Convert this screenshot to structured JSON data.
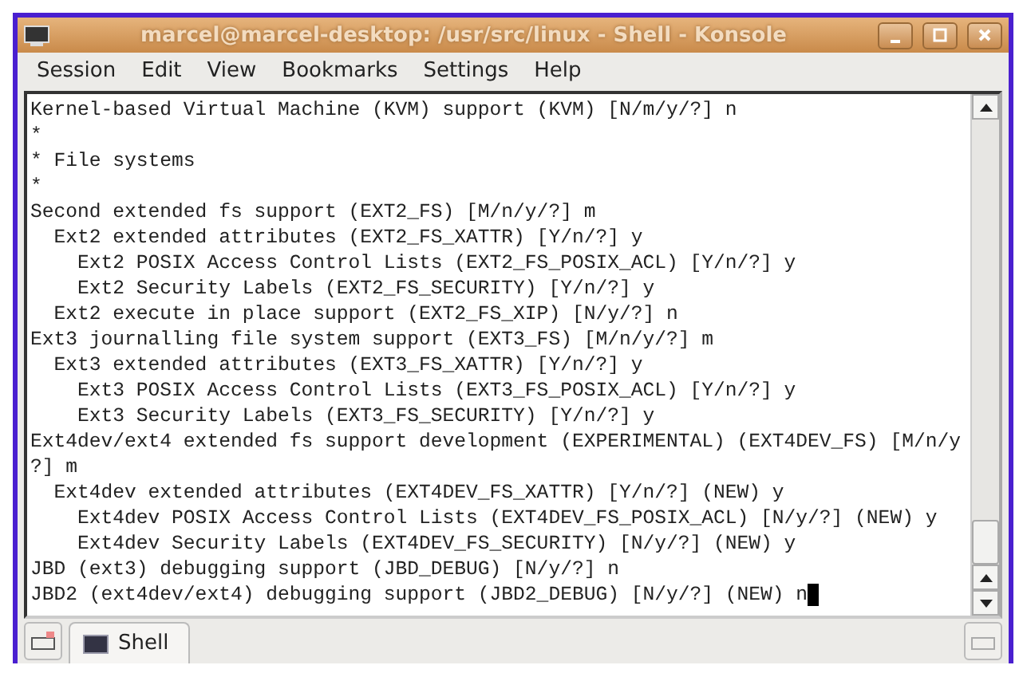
{
  "window": {
    "title": "marcel@marcel-desktop: /usr/src/linux - Shell - Konsole"
  },
  "menu": [
    "Session",
    "Edit",
    "View",
    "Bookmarks",
    "Settings",
    "Help"
  ],
  "terminal": {
    "lines": [
      "Kernel-based Virtual Machine (KVM) support (KVM) [N/m/y/?] n",
      "*",
      "* File systems",
      "*",
      "Second extended fs support (EXT2_FS) [M/n/y/?] m",
      "  Ext2 extended attributes (EXT2_FS_XATTR) [Y/n/?] y",
      "    Ext2 POSIX Access Control Lists (EXT2_FS_POSIX_ACL) [Y/n/?] y",
      "    Ext2 Security Labels (EXT2_FS_SECURITY) [Y/n/?] y",
      "  Ext2 execute in place support (EXT2_FS_XIP) [N/y/?] n",
      "Ext3 journalling file system support (EXT3_FS) [M/n/y/?] m",
      "  Ext3 extended attributes (EXT3_FS_XATTR) [Y/n/?] y",
      "    Ext3 POSIX Access Control Lists (EXT3_FS_POSIX_ACL) [Y/n/?] y",
      "    Ext3 Security Labels (EXT3_FS_SECURITY) [Y/n/?] y",
      "Ext4dev/ext4 extended fs support development (EXPERIMENTAL) (EXT4DEV_FS) [M/n/y",
      "?] m",
      "  Ext4dev extended attributes (EXT4DEV_FS_XATTR) [Y/n/?] (NEW) y",
      "    Ext4dev POSIX Access Control Lists (EXT4DEV_FS_POSIX_ACL) [N/y/?] (NEW) y",
      "    Ext4dev Security Labels (EXT4DEV_FS_SECURITY) [N/y/?] (NEW) y",
      "JBD (ext3) debugging support (JBD_DEBUG) [N/y/?] n",
      "JBD2 (ext4dev/ext4) debugging support (JBD2_DEBUG) [N/y/?] (NEW) n"
    ]
  },
  "tabs": [
    {
      "label": "Shell",
      "selected": true
    }
  ]
}
